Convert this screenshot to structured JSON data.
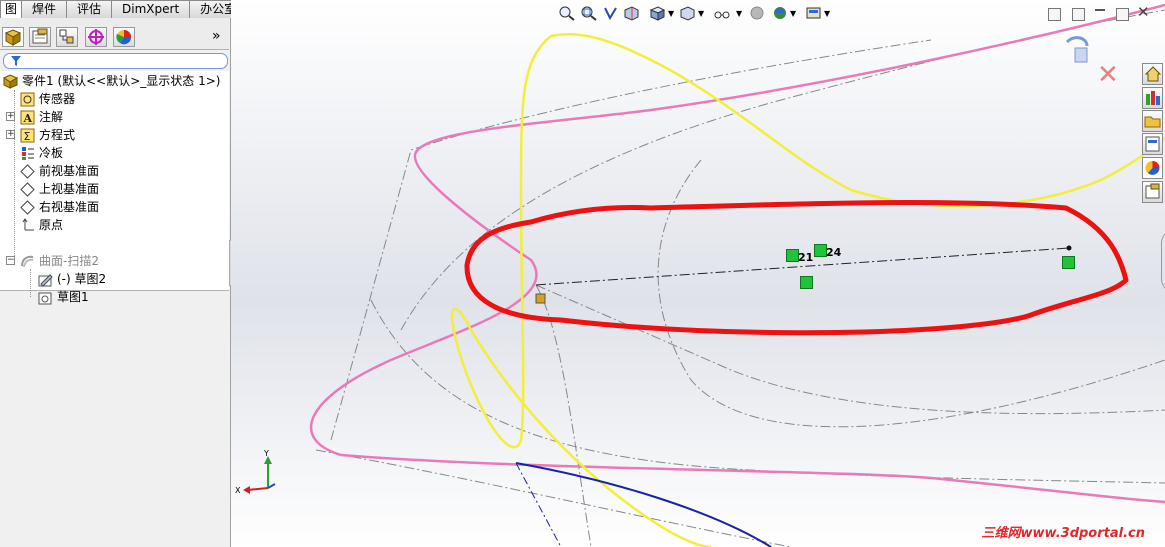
{
  "top_tabs": [
    "图",
    "焊件",
    "评估",
    "DimXpert",
    "办公室产品"
  ],
  "panel_tabs": [
    "feature-manager-icon",
    "property-manager-icon",
    "configuration-manager-icon",
    "dimxpert-manager-icon",
    "display-manager-icon"
  ],
  "panel_more": "»",
  "tree": {
    "root": "零件1  (默认<<默认>_显示状态 1>)",
    "items": [
      {
        "label": "传感器",
        "icon": "sensor-icon",
        "expandable": false
      },
      {
        "label": "注解",
        "icon": "annotation-icon",
        "expandable": true
      },
      {
        "label": "方程式",
        "icon": "equation-icon",
        "expandable": true
      },
      {
        "label": "冷板",
        "icon": "material-icon",
        "expandable": false
      },
      {
        "label": "前视基准面",
        "icon": "plane-icon",
        "expandable": false
      },
      {
        "label": "上视基准面",
        "icon": "plane-icon",
        "expandable": false
      },
      {
        "label": "右视基准面",
        "icon": "plane-icon",
        "expandable": false
      },
      {
        "label": "原点",
        "icon": "origin-icon",
        "expandable": false
      },
      {
        "label": "曲面-扫描2",
        "icon": "sweep-surface-icon",
        "expandable": true,
        "expanded": true
      },
      {
        "label": "(-)  草图2",
        "icon": "sketch-icon",
        "expandable": false
      },
      {
        "label": "草图1",
        "icon": "sketch-icon",
        "expandable": false
      }
    ]
  },
  "sketch_relations": {
    "r1": "21",
    "r2": "24"
  },
  "triad": {
    "y": "Y",
    "x": "X"
  },
  "watermark": "三维网www.3dportal.cn",
  "colors": {
    "annotation_red": "#ee1111",
    "curve_pink": "#e87ab8",
    "curve_yellow": "#f2ee3a",
    "curve_blue": "#1a22aa",
    "relation_green": "#22c23a"
  }
}
